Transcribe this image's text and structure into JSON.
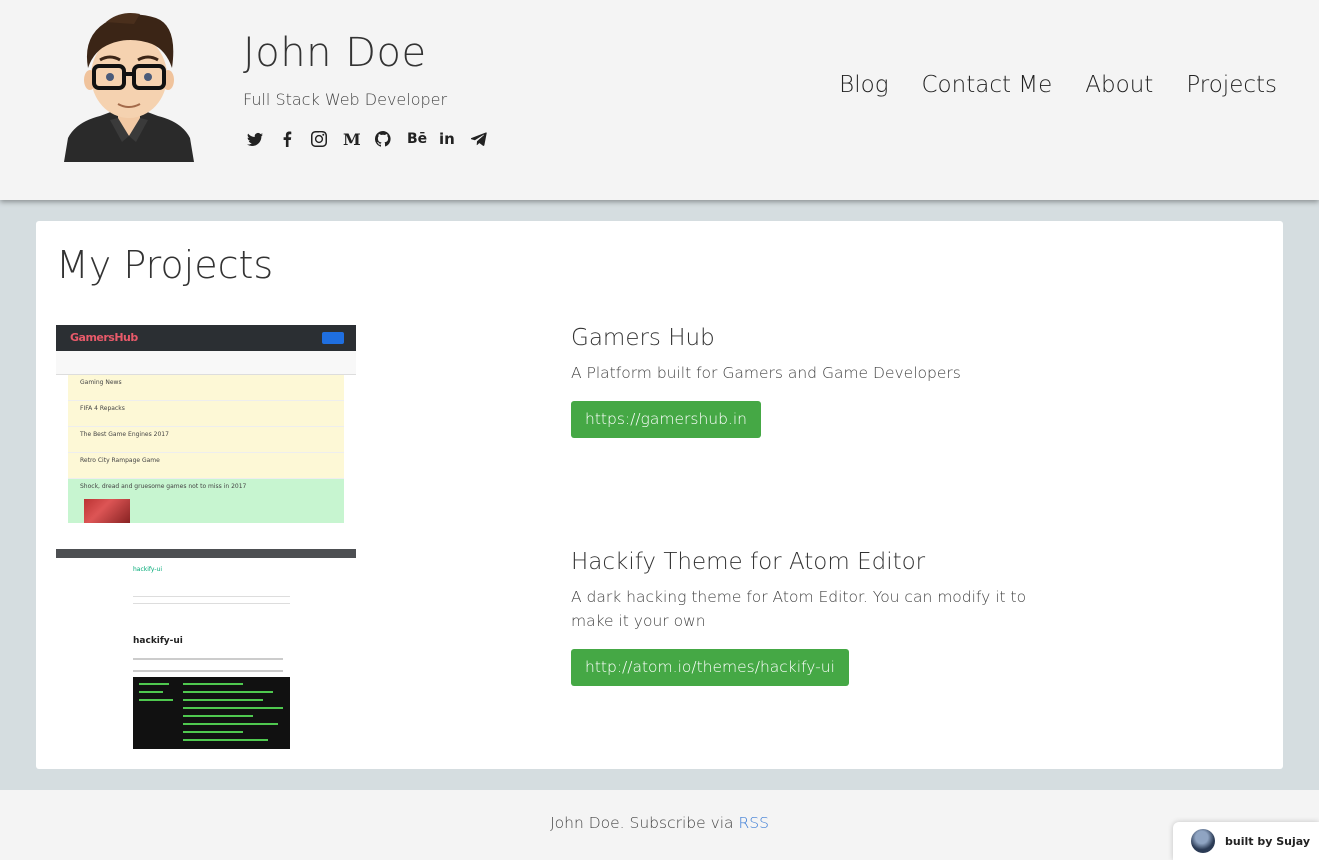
{
  "header": {
    "name": "John Doe",
    "tagline": "Full Stack Web Developer",
    "social_icons": [
      "twitter-icon",
      "facebook-icon",
      "instagram-icon",
      "medium-icon",
      "github-icon",
      "behance-icon",
      "linkedin-icon",
      "telegram-icon"
    ],
    "medium_glyph": "M",
    "behance_glyph": "Bē",
    "linkedin_glyph": "in"
  },
  "nav": {
    "items": [
      {
        "label": "Blog"
      },
      {
        "label": "Contact Me"
      },
      {
        "label": "About"
      },
      {
        "label": "Projects"
      }
    ]
  },
  "main": {
    "title": "My Projects",
    "projects": [
      {
        "title": "Gamers Hub",
        "description": "A Platform built for Gamers and Game Developers",
        "link": "https://gamershub.in",
        "screenshot": {
          "logo": "GamersHub",
          "rows": [
            "Gaming News",
            "FIFA 4 Repacks",
            "The Best Game Engines 2017",
            "Retro City Rampage Game"
          ],
          "highlight": "Shock, dread and gruesome games not to miss in 2017"
        }
      },
      {
        "title": "Hackify Theme for Atom Editor",
        "description": "A dark hacking theme for Atom Editor. You can modify it to make it your own",
        "link": "http://atom.io/themes/hackify-ui",
        "screenshot": {
          "package": "hackify-ui"
        }
      }
    ]
  },
  "footer": {
    "text": "John Doe. Subscribe via ",
    "link": "RSS"
  },
  "badge": {
    "label": "built by Sujay"
  },
  "colors": {
    "button_green": "#45a845",
    "link_blue": "#3a7bd5",
    "header_bg": "#f4f4f4",
    "page_bg": "#d5dde0"
  }
}
